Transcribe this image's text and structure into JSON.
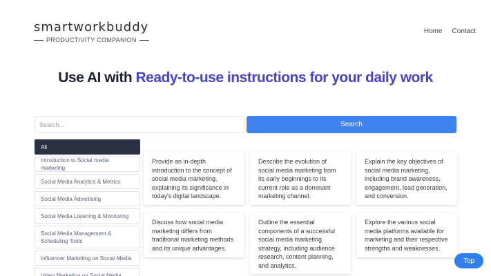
{
  "brand": {
    "name": "smartworkbuddy",
    "tagline": "PRODUCTIVITY COMPANION"
  },
  "nav": {
    "home": "Home",
    "contact": "Contact"
  },
  "hero": {
    "lead": "Use AI with ",
    "accent": "Ready-to-use instructions for your daily work"
  },
  "search": {
    "placeholder": "Search...",
    "button": "Search"
  },
  "categories": [
    "All",
    "Introduction to Social media marketing",
    "Social Media Analytics & Metrics",
    "Social Media Advertising",
    "Social Media Listening & Monitoring",
    "Social Media Management & Scheduling Tools",
    "Influencer Marketing on Social Media",
    "Video Marketing on Social Media"
  ],
  "cards": [
    "Provide an in-depth introduction to the concept of social media marketing, explaining its significance in today's digital landscape.",
    "Describe the evolution of social media marketing from its early beginnings to its current role as a dominant marketing channel.",
    "Explain the key objectives of social media marketing, including brand awareness, engagement, lead generation, and conversion.",
    "Discuss how social media marketing differs from traditional marketing methods and its unique advantages.",
    "Outline the essential components of a successful social media marketing strategy, including audience research, content planning, and analytics.",
    "Explore the various social media platforms available for marketing and their respective strengths and weaknesses."
  ],
  "top_button": "Top",
  "colors": {
    "accent": "#4a44c6",
    "primary_button": "#3f83ef",
    "active_category": "#2b3142"
  }
}
